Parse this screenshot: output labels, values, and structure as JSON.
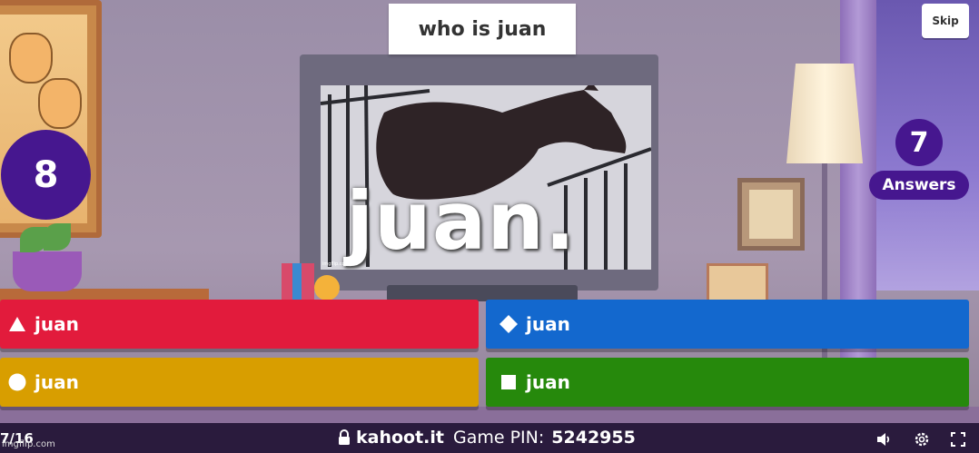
{
  "question": {
    "text": "who is juan"
  },
  "controls": {
    "skip_label": "Skip"
  },
  "timer": {
    "seconds": "8"
  },
  "answers_count": {
    "value": "7",
    "label": "Answers"
  },
  "media": {
    "caption": "juan.",
    "watermark": "imgflip.com"
  },
  "answers": [
    {
      "shape": "triangle-icon",
      "label": "juan",
      "color": "#e21b3c"
    },
    {
      "shape": "diamond-icon",
      "label": "juan",
      "color": "#1368ce"
    },
    {
      "shape": "circle-icon",
      "label": "juan",
      "color": "#d89e00"
    },
    {
      "shape": "square-icon",
      "label": "juan",
      "color": "#26890c"
    }
  ],
  "bottom_bar": {
    "progress": "7/16",
    "domain": "kahoot.it",
    "pin_label": "Game PIN:",
    "pin_value": "5242955"
  },
  "watermark": "imgflip.com",
  "theme": {
    "purple": "#46178f",
    "bar": "#2a1b3d"
  }
}
